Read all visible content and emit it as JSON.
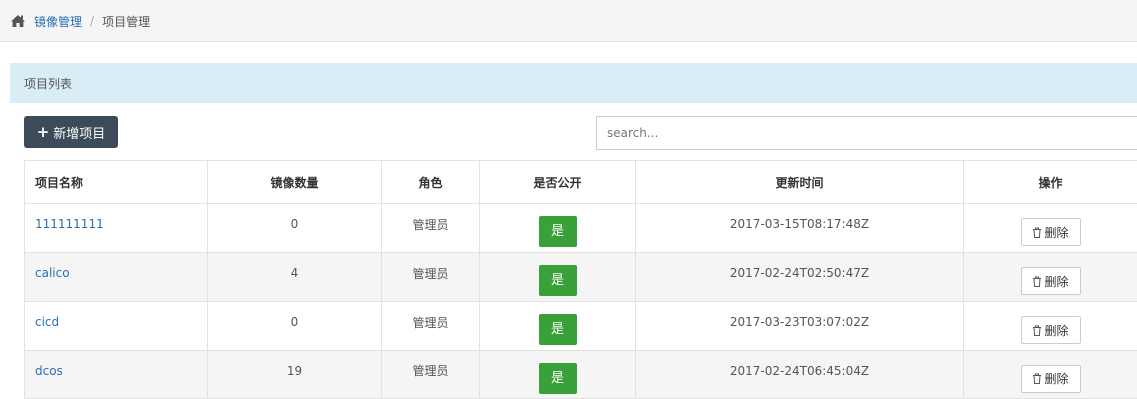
{
  "breadcrumb": {
    "icon": "home-icon",
    "link": "镜像管理",
    "separator": "/",
    "current": "项目管理"
  },
  "panel": {
    "title": "项目列表"
  },
  "toolbar": {
    "add_icon": "plus-icon",
    "add_label": "新增项目",
    "search_placeholder": "search..."
  },
  "table": {
    "headers": [
      "项目名称",
      "镜像数量",
      "角色",
      "是否公开",
      "更新时间",
      "操作"
    ],
    "rows": [
      {
        "name": "111111111",
        "count": "0",
        "role": "管理员",
        "public": "是",
        "updated": "2017-03-15T08:17:48Z",
        "action": "删除"
      },
      {
        "name": "calico",
        "count": "4",
        "role": "管理员",
        "public": "是",
        "updated": "2017-02-24T02:50:47Z",
        "action": "删除"
      },
      {
        "name": "cicd",
        "count": "0",
        "role": "管理员",
        "public": "是",
        "updated": "2017-03-23T03:07:02Z",
        "action": "删除"
      },
      {
        "name": "dcos",
        "count": "19",
        "role": "管理员",
        "public": "是",
        "updated": "2017-02-24T06:45:04Z",
        "action": "删除"
      }
    ]
  },
  "colors": {
    "link": "#2a6fb1",
    "panel_header": "#d9edf7",
    "add_button": "#3d4a5a",
    "public_badge": "#3aa03a"
  }
}
